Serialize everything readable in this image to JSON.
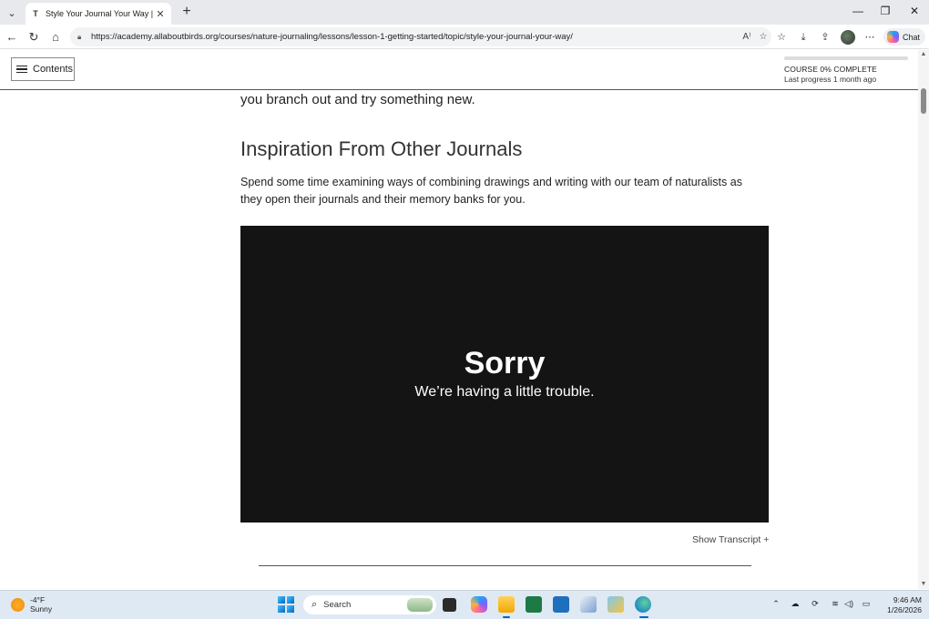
{
  "browser": {
    "tab_title": "Style Your Journal Your Way | Bird",
    "tab_favicon": "T",
    "url": "https://academy.allaboutbirds.org/courses/nature-journaling/lessons/lesson-1-getting-started/topic/style-your-journal-your-way/",
    "chat_label": "Chat"
  },
  "header": {
    "contents_label": "Contents",
    "progress_fraction": 0.0,
    "progress_label": "COURSE 0% COMPLETE",
    "progress_sub": "Last progress 1 month ago"
  },
  "content": {
    "fragment": "you branch out and try something new.",
    "heading": "Inspiration From Other Journals",
    "paragraph": "Spend some time examining ways of combining drawings and writing with our team of naturalists as they open their journals and their memory banks for you.",
    "video_error_title": "Sorry",
    "video_error_sub": "We’re having a little trouble.",
    "transcript_label": "Show Transcript +"
  },
  "taskbar": {
    "temperature": "-4°F",
    "weather": "Sunny",
    "search_label": "Search",
    "time": "9:46 AM",
    "date": "1/26/2026"
  }
}
